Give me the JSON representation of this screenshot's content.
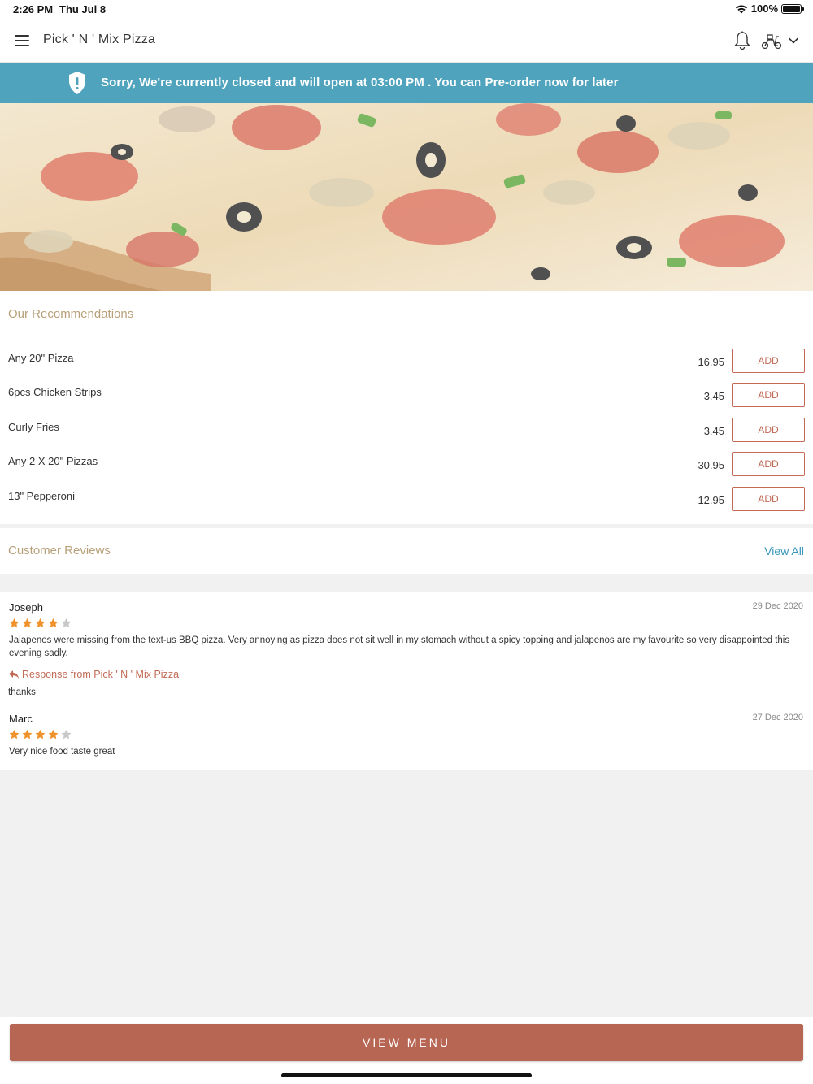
{
  "status_bar": {
    "time": "2:26 PM",
    "date": "Thu Jul 8",
    "battery": "100%"
  },
  "header": {
    "title": "Pick ' N ' Mix Pizza",
    "icons": [
      "menu-icon",
      "bell-icon",
      "scooter-icon",
      "chevron-down-icon"
    ]
  },
  "banner": {
    "text": "Sorry, We're currently closed and will open at 03:00 PM . You can Pre-order now for later",
    "color": "#4fa3bd",
    "icon": "shield-icon"
  },
  "recommendations": {
    "title": "Our Recommendations",
    "items": [
      {
        "name": "Any 20\" Pizza",
        "price": "16.95",
        "button": "ADD"
      },
      {
        "name": "6pcs Chicken Strips",
        "price": "3.45",
        "button": "ADD"
      },
      {
        "name": "Curly Fries",
        "price": "3.45",
        "button": "ADD"
      },
      {
        "name": "Any 2 X 20\" Pizzas",
        "price": "30.95",
        "button": "ADD"
      },
      {
        "name": "13\" Pepperoni",
        "price": "12.95",
        "button": "ADD"
      }
    ]
  },
  "reviews": {
    "title": "Customer Reviews",
    "view_all": "View All",
    "items": [
      {
        "name": "Joseph",
        "date": "29 Dec 2020",
        "rating": 4,
        "text": "Jalapenos were missing from the text-us BBQ pizza. Very annoying as pizza does not sit well in my stomach without a spicy topping and jalapenos are my favourite so very disappointed this evening sadly.",
        "response_label": "Response from Pick ' N ' Mix Pizza",
        "response": "thanks"
      },
      {
        "name": "Marc",
        "date": "27 Dec 2020",
        "rating": 4,
        "text": "Very nice food taste great"
      }
    ]
  },
  "footer": {
    "button": "VIEW MENU"
  },
  "colors": {
    "accent": "#b86654",
    "link": "#3b97b8",
    "section_title": "#b8a07a",
    "star": "#f0922b",
    "star_empty": "#c8c8c8"
  }
}
